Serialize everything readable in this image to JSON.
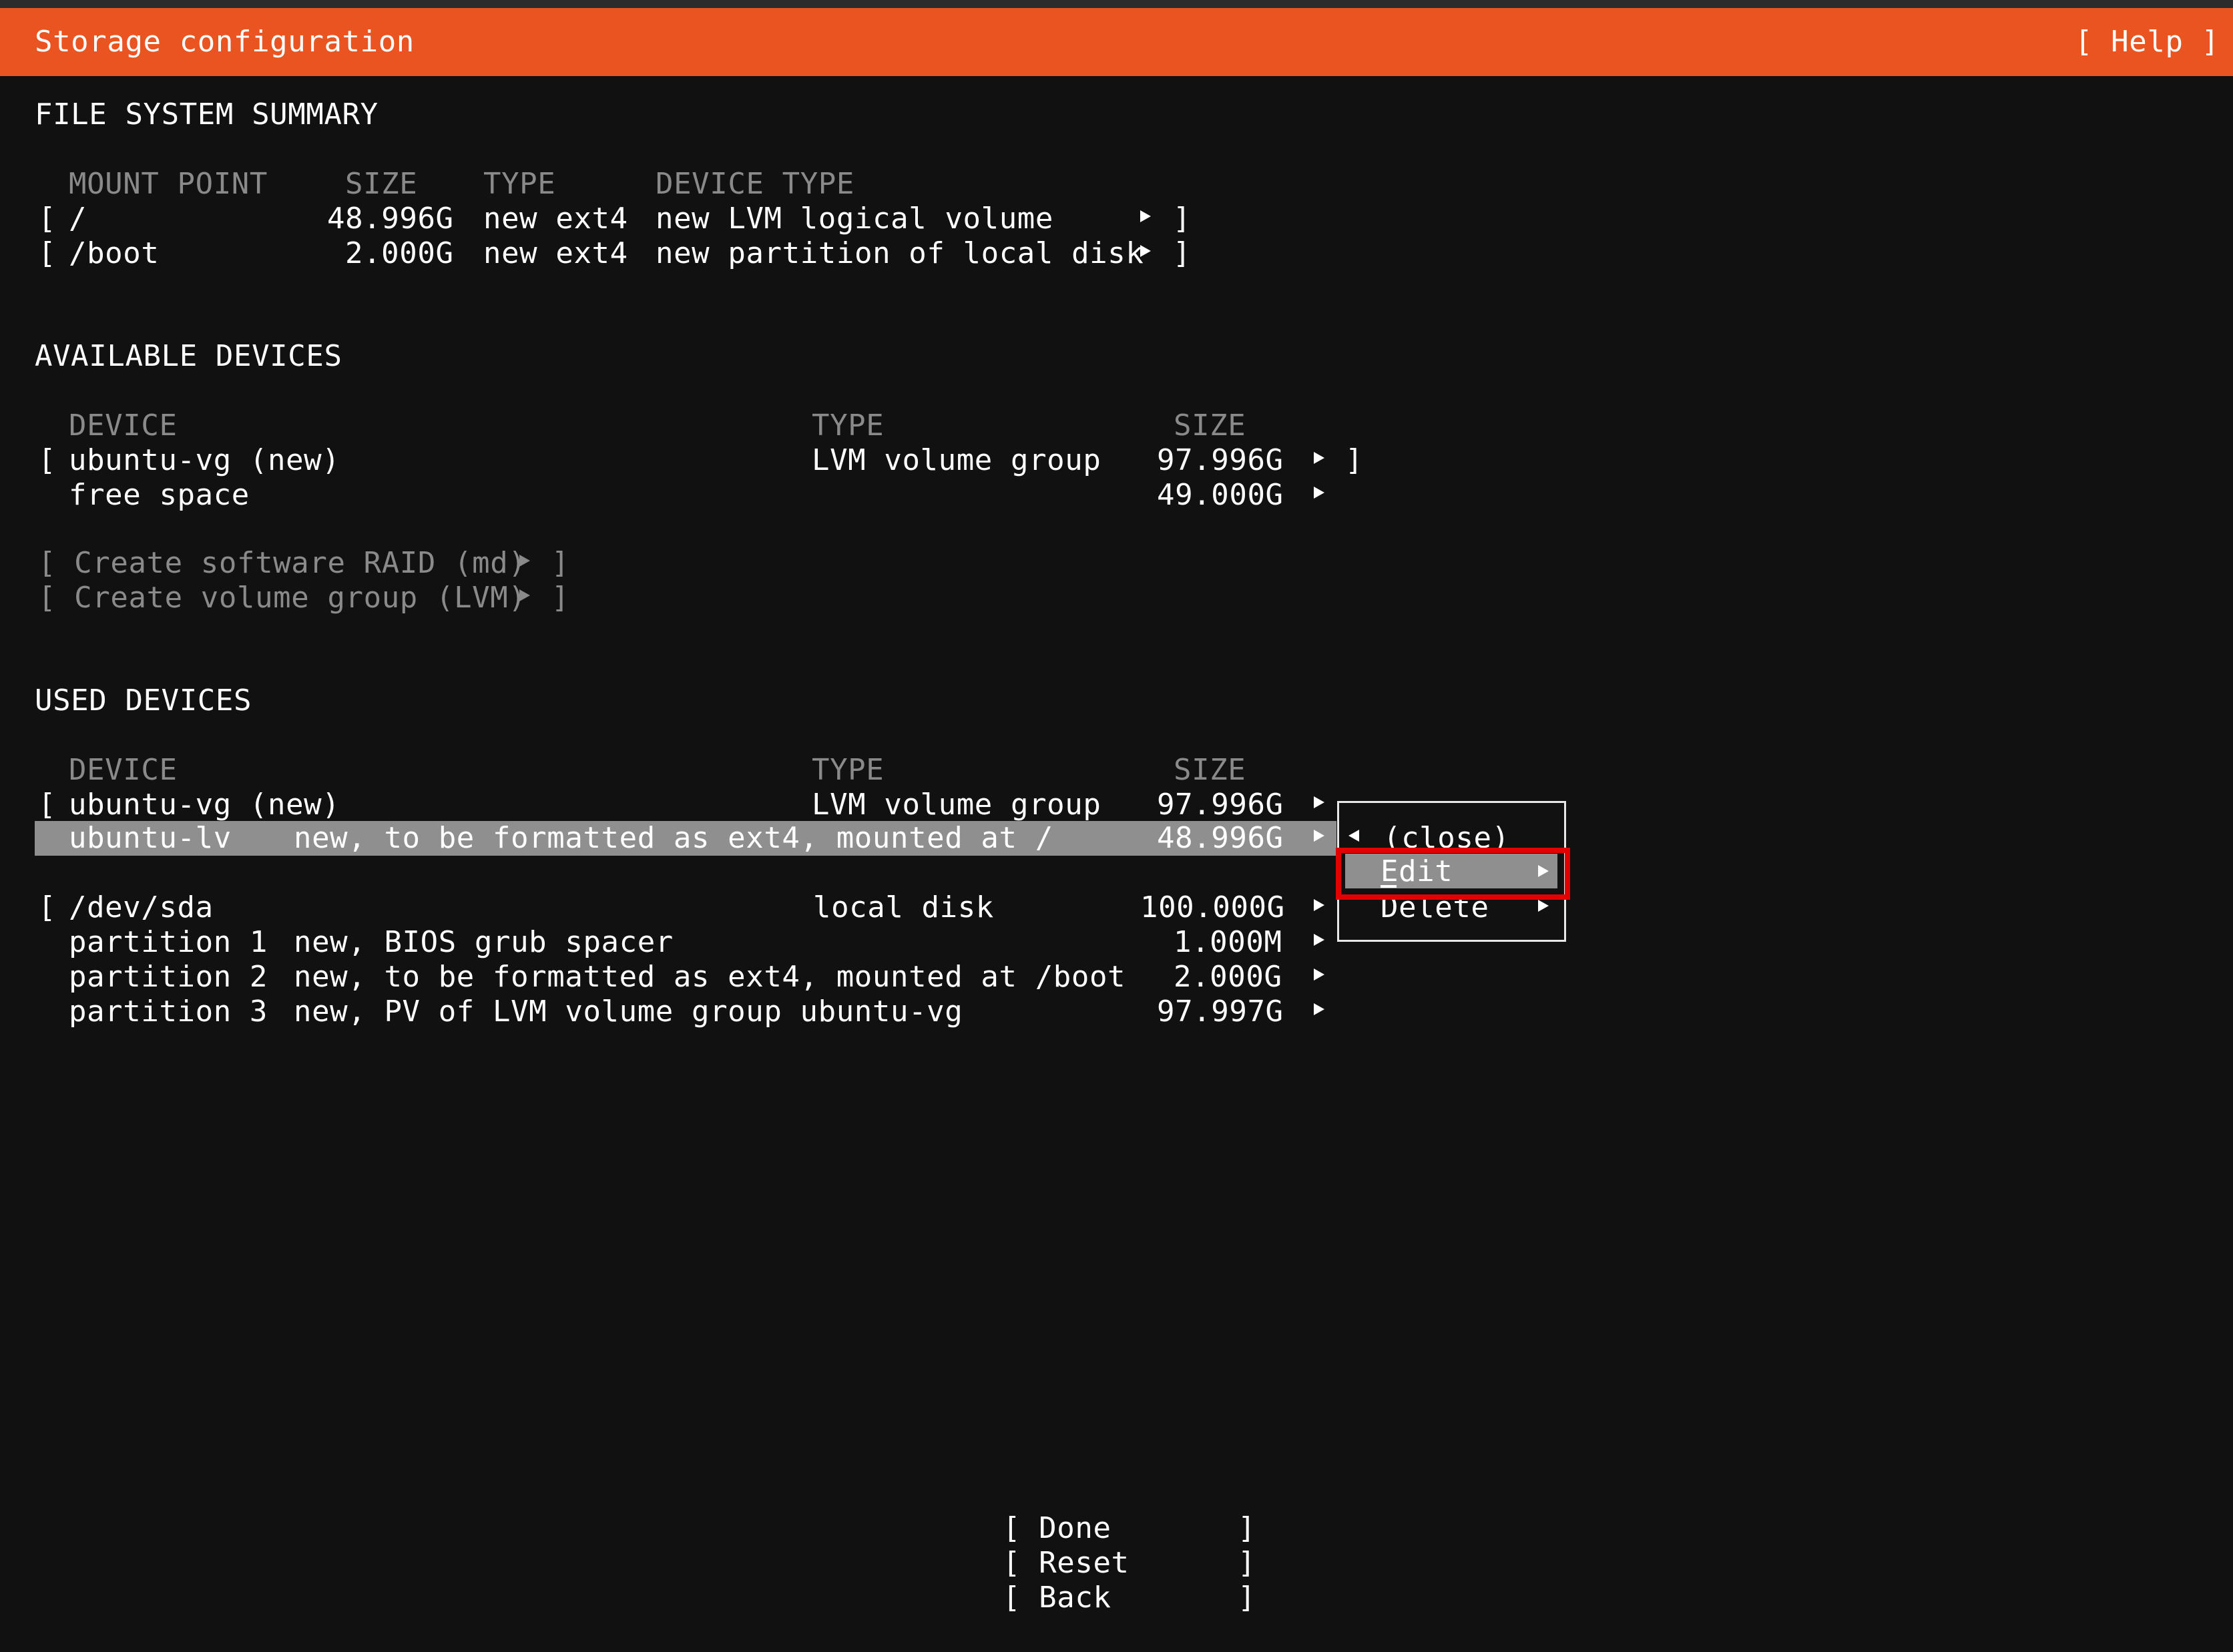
{
  "header": {
    "title": "Storage configuration",
    "help": "[ Help ]"
  },
  "fs_summary": {
    "heading": "FILE SYSTEM SUMMARY",
    "col_mount": "MOUNT POINT",
    "col_size": "SIZE",
    "col_type": "TYPE",
    "col_devtype": "DEVICE TYPE",
    "rows": [
      {
        "open": "[",
        "mount": "/",
        "size": "48.996G",
        "type": "new ext4",
        "devtype": "new LVM logical volume",
        "close": "]"
      },
      {
        "open": "[",
        "mount": "/boot",
        "size": "2.000G",
        "type": "new ext4",
        "devtype": "new partition of local disk",
        "close": "]"
      }
    ]
  },
  "available": {
    "heading": "AVAILABLE DEVICES",
    "col_device": "DEVICE",
    "col_type": "TYPE",
    "col_size": "SIZE",
    "rows": [
      {
        "open": "[",
        "device": "ubuntu-vg (new)",
        "type": "LVM volume group",
        "size": "97.996G",
        "close": "]"
      },
      {
        "device": "free space",
        "size": "49.000G"
      }
    ],
    "raid_label": "[ Create software RAID (md)",
    "vg_label": "[ Create volume group (LVM)",
    "bracket_close": "]"
  },
  "used": {
    "heading": "USED DEVICES",
    "col_device": "DEVICE",
    "col_type": "TYPE",
    "col_size": "SIZE",
    "vg_row": {
      "open": "[",
      "device": "ubuntu-vg (new)",
      "type": "LVM volume group",
      "size": "97.996G"
    },
    "lv_row": {
      "device": "ubuntu-lv",
      "desc": "new, to be formatted as ext4, mounted at /",
      "size": "48.996G"
    },
    "sda_row": {
      "open": "[",
      "device": "/dev/sda",
      "type": "local disk",
      "size": "100.000G"
    },
    "partitions": [
      {
        "name": "partition 1",
        "desc": "new, BIOS grub spacer",
        "size": "1.000M"
      },
      {
        "name": "partition 2",
        "desc": "new, to be formatted as ext4, mounted at /boot",
        "size": "2.000G"
      },
      {
        "name": "partition 3",
        "desc": "new, PV of LVM volume group ubuntu-vg",
        "size": "97.997G"
      }
    ]
  },
  "context_menu": {
    "close": "(close)",
    "edit": "Edit",
    "delete": "Delete"
  },
  "footer": {
    "done": "[ Done       ]",
    "reset": "[ Reset      ]",
    "back": "[ Back       ]"
  },
  "colors": {
    "accent": "#e95420",
    "background": "#111111",
    "highlight": "#8f8f8f",
    "annotation": "#e20000"
  }
}
